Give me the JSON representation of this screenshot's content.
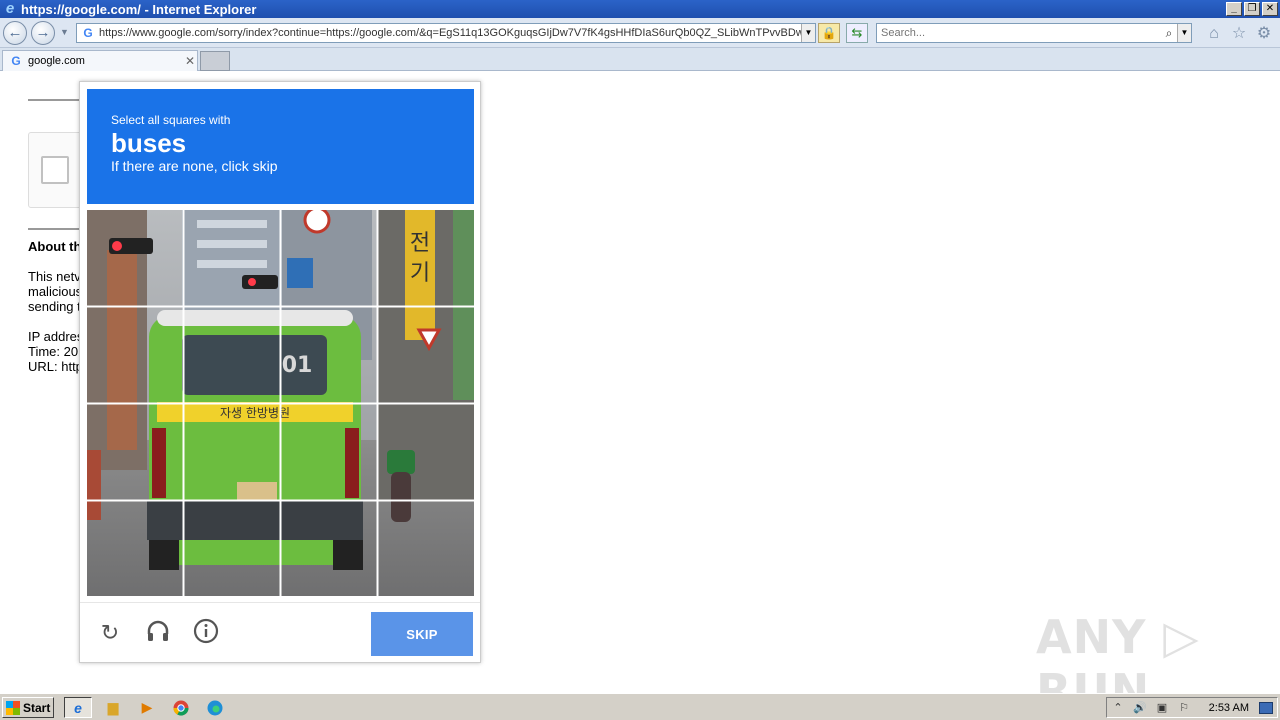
{
  "window": {
    "title": "https://google.com/ - Internet Explorer",
    "logo_glyph": "e"
  },
  "address_bar": {
    "url": "https://www.google.com/sorry/index?continue=https://google.com/&q=EgS11q13GOKguqsGIjDw7V7fK4gsHHfDIaS6urQb0QZ_SLibWnTPvvBDwt"
  },
  "search_box": {
    "placeholder": "Search..."
  },
  "tabs": [
    {
      "label": "google.com"
    }
  ],
  "page": {
    "about_heading": "About th",
    "paragraph": [
      "This netv",
      "malicious",
      "sending t"
    ],
    "details": [
      "IP addres",
      "Time: 20",
      "URL: http"
    ]
  },
  "captcha": {
    "instruction": "Select all squares with",
    "target": "buses",
    "hint": "If there are none, click skip",
    "skip_label": "SKIP",
    "grid_rows": 4,
    "grid_cols": 4
  },
  "watermark": "ANY ▷ RUN",
  "taskbar": {
    "start_label": "Start",
    "clock": "2:53 AM"
  }
}
